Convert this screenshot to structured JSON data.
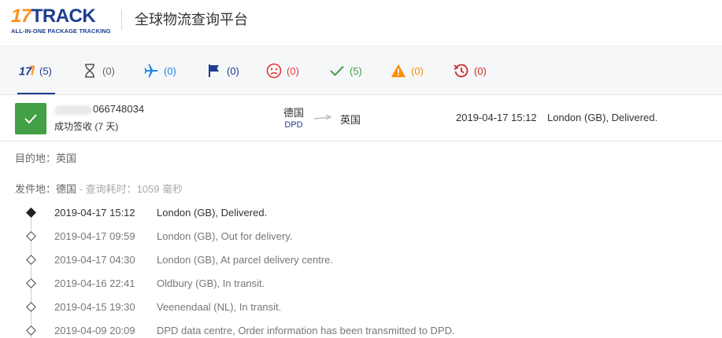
{
  "header": {
    "logo_number": "17",
    "logo_word": "TRACK",
    "logo_tagline": "ALL-IN-ONE PACKAGE TRACKING",
    "title": "全球物流查询平台"
  },
  "tabs": [
    {
      "id": "all",
      "icon": "17track-logo-icon",
      "count": "(5)",
      "color": "#1e3d8f"
    },
    {
      "id": "not-found",
      "icon": "hourglass-icon",
      "count": "(0)",
      "color": "#666666"
    },
    {
      "id": "in-transit",
      "icon": "airplane-icon",
      "count": "(0)",
      "color": "#1e88e5"
    },
    {
      "id": "pickup",
      "icon": "flag-icon",
      "count": "(0)",
      "color": "#1e3d8f"
    },
    {
      "id": "undelivered",
      "icon": "sad-face-icon",
      "count": "(0)",
      "color": "#e53935"
    },
    {
      "id": "delivered",
      "icon": "checkmark-icon",
      "count": "(5)",
      "color": "#43a047"
    },
    {
      "id": "alert",
      "icon": "warning-icon",
      "count": "(0)",
      "color": "#fb8c00"
    },
    {
      "id": "expired",
      "icon": "history-icon",
      "count": "(0)",
      "color": "#c62828"
    }
  ],
  "package": {
    "number_visible": "066748034",
    "status_text": "成功签收 (7 天)",
    "origin_country": "德国",
    "carrier": "DPD",
    "destination_country": "英国",
    "latest_time": "2019-04-17 15:12",
    "latest_desc": "London (GB), Delivered.",
    "status_color": "#43a047"
  },
  "details": {
    "destination_label": "目的地",
    "destination_value": "：英国",
    "origin_label": "发件地",
    "origin_value": "：德国",
    "query_time": " - 查询耗时：1059 毫秒"
  },
  "events": [
    {
      "time": "2019-04-17 15:12",
      "desc": "London (GB), Delivered."
    },
    {
      "time": "2019-04-17 09:59",
      "desc": "London (GB), Out for delivery."
    },
    {
      "time": "2019-04-17 04:30",
      "desc": "London (GB), At parcel delivery centre."
    },
    {
      "time": "2019-04-16 22:41",
      "desc": "Oldbury (GB), In transit."
    },
    {
      "time": "2019-04-15 19:30",
      "desc": "Veenendaal (NL), In transit."
    },
    {
      "time": "2019-04-09 20:09",
      "desc": "DPD data centre, Order information has been transmitted to DPD."
    }
  ]
}
